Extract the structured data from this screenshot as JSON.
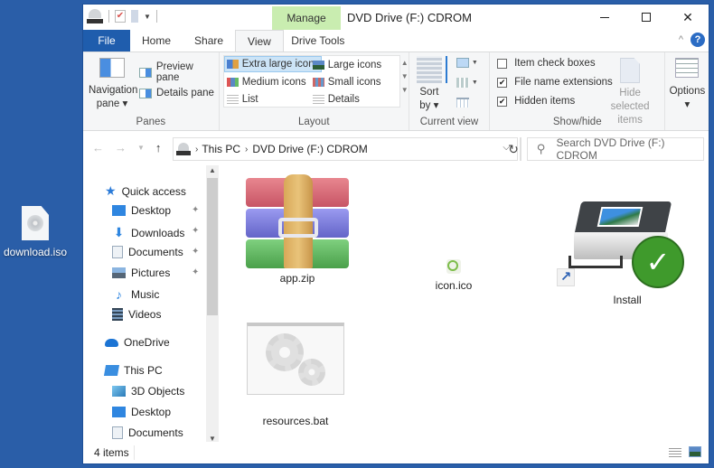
{
  "desktop": {
    "icons": [
      {
        "label": "download.iso",
        "icon": "disc-image-file-icon"
      }
    ]
  },
  "window": {
    "title": "DVD Drive (F:) CDROM",
    "contextual_tab": "Manage",
    "controls": {
      "minimize": "minimize",
      "maximize": "maximize",
      "close": "✕"
    }
  },
  "ribbon": {
    "tabs": [
      {
        "label": "File"
      },
      {
        "label": "Home"
      },
      {
        "label": "Share"
      },
      {
        "label": "View",
        "active": true
      },
      {
        "label": "Drive Tools"
      }
    ],
    "collapse_glyph": "^",
    "help_glyph": "?",
    "panes": {
      "label": "Panes",
      "navigation_pane": "Navigation pane",
      "nav_pane_dropdown": "▾",
      "preview_pane": "Preview pane",
      "details_pane": "Details pane"
    },
    "layout": {
      "label": "Layout",
      "options": [
        {
          "label": "Extra large icons",
          "selected": true
        },
        {
          "label": "Large icons"
        },
        {
          "label": "Medium icons"
        },
        {
          "label": "Small icons"
        },
        {
          "label": "List"
        },
        {
          "label": "Details"
        }
      ]
    },
    "current_view": {
      "label": "Current view",
      "sort_by": "Sort by",
      "sort_dropdown": "▾"
    },
    "show_hide": {
      "label": "Show/hide",
      "item_check_boxes": {
        "label": "Item check boxes",
        "checked": false
      },
      "file_name_extensions": {
        "label": "File name extensions",
        "checked": true
      },
      "hidden_items": {
        "label": "Hidden items",
        "checked": true
      },
      "hide_selected_items": "Hide selected items",
      "check_glyph": "✔"
    },
    "options": {
      "label": "Options",
      "dropdown": "▾"
    }
  },
  "address_bar": {
    "back": "←",
    "forward": "→",
    "recent": "⌄",
    "up": "↑",
    "breadcrumb": [
      "This PC",
      "DVD Drive (F:) CDROM"
    ],
    "separator": "›",
    "dropdown": "⌄",
    "refresh": "↻",
    "search_placeholder": "Search DVD Drive (F:) CDROM",
    "search_glyph": "⚲"
  },
  "nav_pane": {
    "quick_access": {
      "label": "Quick access",
      "items": [
        {
          "label": "Desktop",
          "pinned": true
        },
        {
          "label": "Downloads",
          "pinned": true
        },
        {
          "label": "Documents",
          "pinned": true
        },
        {
          "label": "Pictures",
          "pinned": true
        },
        {
          "label": "Music"
        },
        {
          "label": "Videos"
        }
      ]
    },
    "onedrive": "OneDrive",
    "this_pc": {
      "label": "This PC",
      "items": [
        {
          "label": "3D Objects"
        },
        {
          "label": "Desktop"
        },
        {
          "label": "Documents"
        }
      ]
    },
    "pin_glyph": "📌",
    "scroll_up": "^",
    "scroll_down": "⌄"
  },
  "files": [
    {
      "name": "app.zip",
      "type": "archive"
    },
    {
      "name": "icon.ico",
      "type": "icon"
    },
    {
      "name": "Install",
      "type": "shortcut"
    },
    {
      "name": "resources.bat",
      "type": "batch"
    }
  ],
  "shortcut_glyph": "↗",
  "install_check_glyph": "✓",
  "status_bar": {
    "item_count": "4 items"
  },
  "colors": {
    "desktop_bg": "#2a5ea8",
    "file_tab": "#1f5dad",
    "manage_tab": "#c9edb0",
    "selection": "#cce4f7",
    "install_check": "#3f9a2c"
  }
}
